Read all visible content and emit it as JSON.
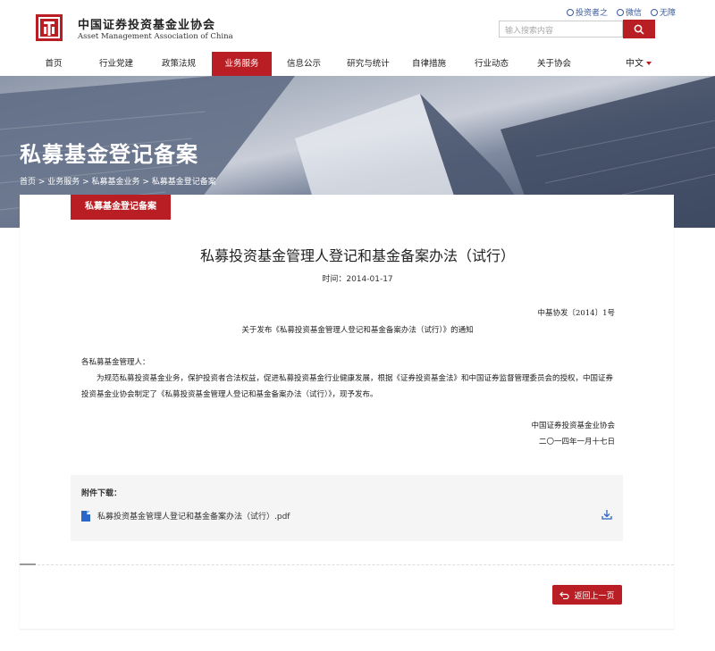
{
  "brand": {
    "name_cn": "中国证券投资基金业协会",
    "name_en": "Asset Management Association of China"
  },
  "toplinks": [
    {
      "label": "投资者之",
      "icon": "user-icon"
    },
    {
      "label": "微信",
      "icon": "wechat-icon"
    },
    {
      "label": "无障",
      "icon": "accessibility-icon"
    }
  ],
  "search": {
    "placeholder": "输入搜索内容"
  },
  "nav": {
    "items": [
      {
        "label": "首页",
        "active": false
      },
      {
        "label": "行业党建",
        "active": false
      },
      {
        "label": "政策法规",
        "active": false
      },
      {
        "label": "业务服务",
        "active": true
      },
      {
        "label": "信息公示",
        "active": false
      },
      {
        "label": "研究与统计",
        "active": false
      },
      {
        "label": "自律措施",
        "active": false
      },
      {
        "label": "行业动态",
        "active": false
      },
      {
        "label": "关于协会",
        "active": false
      }
    ],
    "language": "中文"
  },
  "banner": {
    "title": "私募基金登记备案",
    "breadcrumb": "首页 > 业务服务 > 私募基金业务 > 私募基金登记备案"
  },
  "section_tag": "私募基金登记备案",
  "article": {
    "title": "私募投资基金管理人登记和基金备案办法（试行）",
    "time": "时间：2014-01-17",
    "doc_number": "中基协发〔2014〕1号",
    "subject": "关于发布《私募投资基金管理人登记和基金备案办法（试行）》的通知",
    "greeting": "各私募基金管理人：",
    "body": "为规范私募投资基金业务，保护投资者合法权益，促进私募投资基金行业健康发展，根据《证券投资基金法》和中国证券监督管理委员会的授权，中国证券投资基金业协会制定了《私募投资基金管理人登记和基金备案办法（试行）》，现予发布。",
    "signature_org": "中国证券投资基金业协会",
    "signature_date": "二〇一四年一月十七日"
  },
  "attachments": {
    "title": "附件下载：",
    "files": [
      {
        "name": "私募投资基金管理人登记和基金备案办法（试行）.pdf"
      }
    ]
  },
  "back_button": "返回上一页",
  "colors": {
    "brand_red": "#b81e23",
    "link_blue": "#3a5a9a"
  }
}
